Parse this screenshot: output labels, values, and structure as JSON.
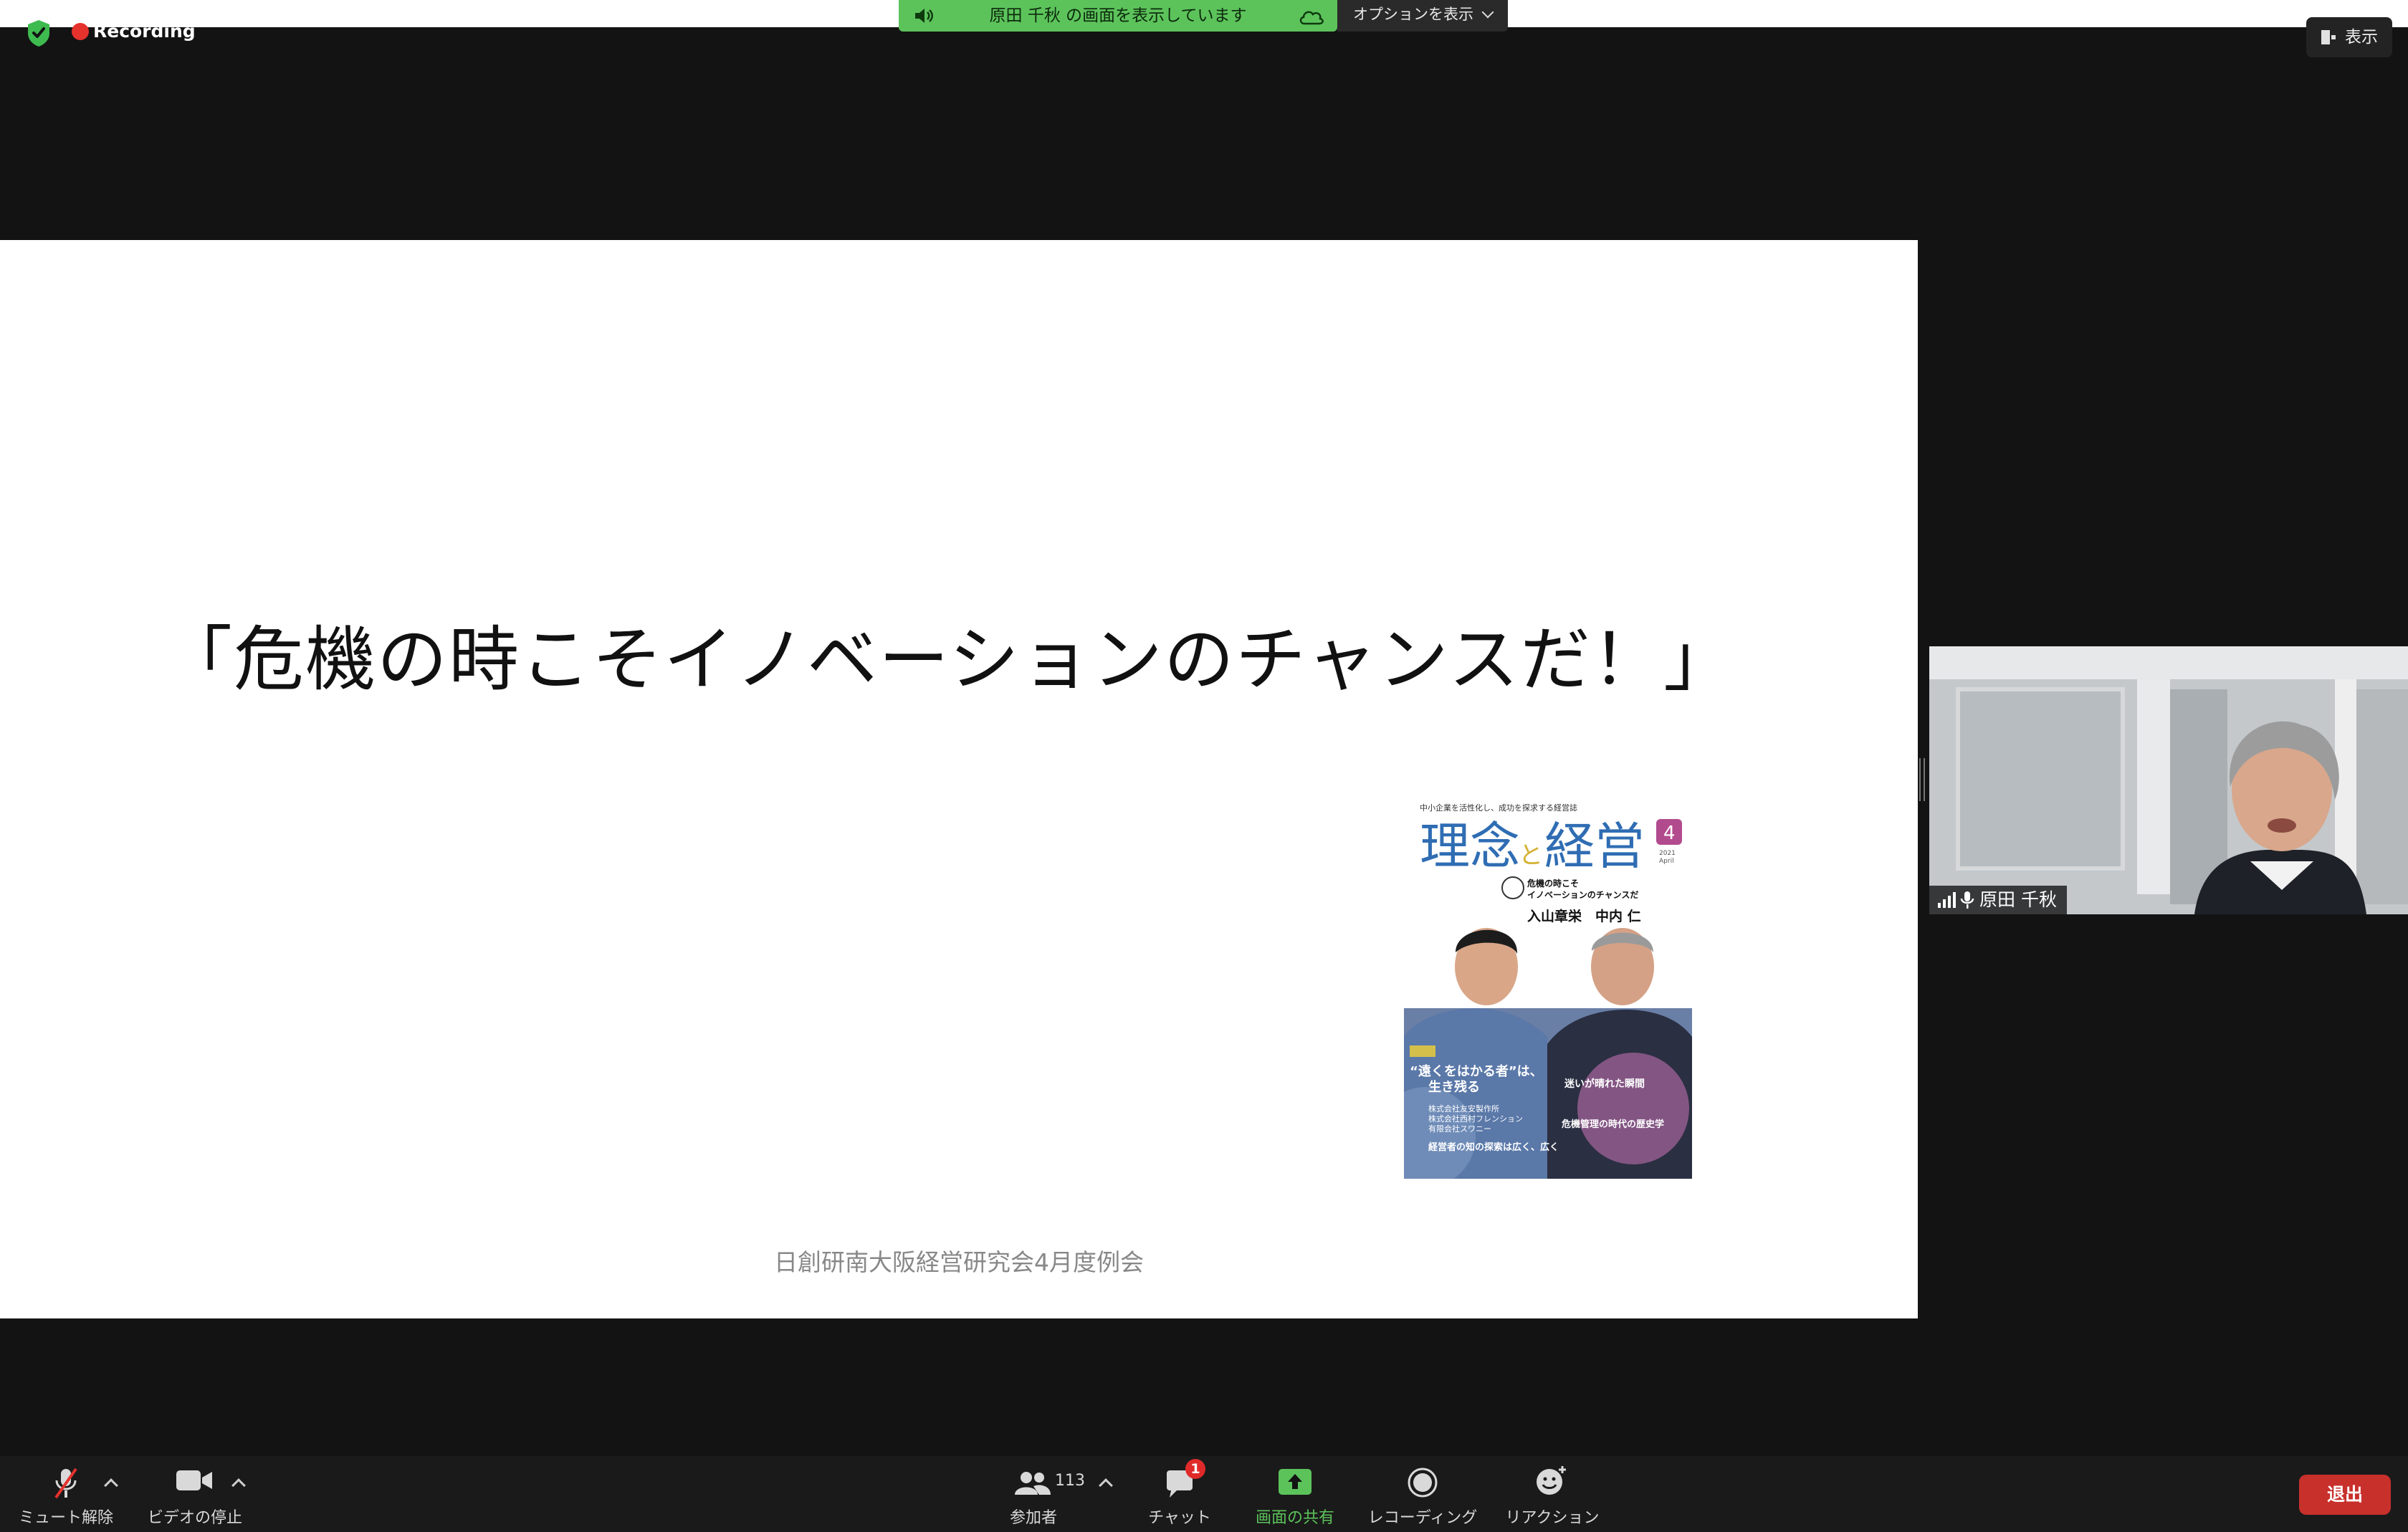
{
  "recording": {
    "label": "Recording"
  },
  "share_banner": {
    "text": "原田 千秋 の画面を表示しています",
    "options_label": "オプションを表示"
  },
  "view_button": {
    "label": "表示"
  },
  "slide": {
    "title": "「危機の時こそイノベーションのチャンスだ！」",
    "footer": "日創研南大阪経営研究会4月度例会",
    "cover": {
      "tagline": "中小企業を活性化し、成功を探求する経営誌",
      "masthead_a": "理念",
      "masthead_b": "と",
      "masthead_c": "経営",
      "issue": "4",
      "year": "2021",
      "month": "April",
      "feature_line1": "危機の時こそ",
      "feature_line2": "イノベーションのチャンスだ",
      "persons": "入山章栄　中内 仁",
      "headline1": "“遠くをはかる者”は、",
      "headline2": "生き残る",
      "companies": [
        "株式会社友安製作所",
        "株式会社西村フレンション",
        "有限会社スワニー"
      ],
      "bottom_line": "経営者の知の探索は広く、広く",
      "right_head": "迷いが晴れた瞬間",
      "right_sub": "危機管理の時代の歴史学"
    }
  },
  "participant": {
    "name": "原田 千秋"
  },
  "toolbar": {
    "mute_label": "ミュート解除",
    "video_label": "ビデオの停止",
    "participants_label": "参加者",
    "participants_count": "113",
    "chat_label": "チャット",
    "chat_badge": "1",
    "share_label": "画面の共有",
    "record_label": "レコーディング",
    "reactions_label": "リアクション",
    "leave_label": "退出"
  },
  "colors": {
    "share_green": "#5cc35b",
    "leave_red": "#c8302c",
    "recording_red": "#e5322d"
  }
}
